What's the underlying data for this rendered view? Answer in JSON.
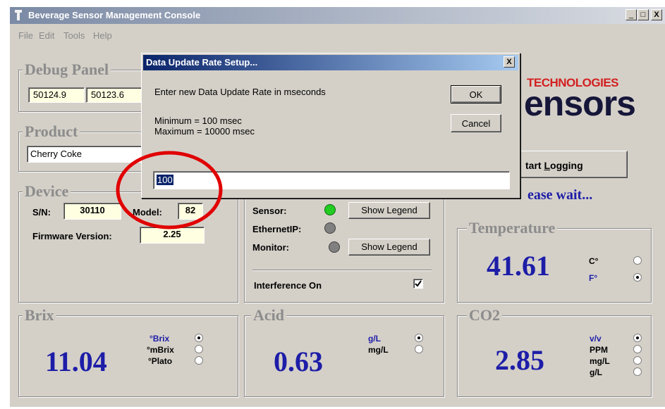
{
  "window": {
    "title": "Beverage Sensor Management Console",
    "controls": {
      "minimize": "_",
      "maximize": "□",
      "close": "X"
    }
  },
  "menu": [
    "File",
    "Edit",
    "Tools",
    "Help"
  ],
  "debug_panel": {
    "title": "Debug Panel",
    "values": [
      "50124.9",
      "50123.6"
    ]
  },
  "logo": {
    "line1": "TECHNOLOGIES",
    "line2": "ensors"
  },
  "product": {
    "title": "Product",
    "value": "Cherry Coke"
  },
  "start_logging": {
    "prefix": "tart ",
    "underlined": "L",
    "rest": "ogging"
  },
  "please_wait": "ease wait...",
  "device": {
    "title": "Device",
    "sn_label": "S/N:",
    "sn_value": "30110",
    "model_label": "Model:",
    "model_value": "82",
    "firmware_label": "Firmware Version:",
    "firmware_value": "2.25"
  },
  "status": {
    "sensor_label": "Sensor:",
    "sensor_led": "#22cc22",
    "ethernet_label": "EthernetIP:",
    "ethernet_led": "#808080",
    "monitor_label": "Monitor:",
    "monitor_led": "#808080",
    "legend_button": "Show Legend",
    "interference_label": "Interference On",
    "interference_checked": true
  },
  "temperature": {
    "title": "Temperature",
    "value": "41.61",
    "units": [
      {
        "label": "C°",
        "selected": false
      },
      {
        "label": "F°",
        "selected": true
      }
    ]
  },
  "brix": {
    "title": "Brix",
    "value": "11.04",
    "units": [
      {
        "label": "°Brix",
        "selected": true
      },
      {
        "label": "°mBrix",
        "selected": false
      },
      {
        "label": "°Plato",
        "selected": false
      }
    ]
  },
  "acid": {
    "title": "Acid",
    "value": "0.63",
    "units": [
      {
        "label": "g/L",
        "selected": true
      },
      {
        "label": "mg/L",
        "selected": false
      }
    ]
  },
  "co2": {
    "title": "CO2",
    "value": "2.85",
    "units": [
      {
        "label": "v/v",
        "selected": true
      },
      {
        "label": "PPM",
        "selected": false
      },
      {
        "label": "mg/L",
        "selected": false
      },
      {
        "label": "g/L",
        "selected": false
      }
    ]
  },
  "dialog": {
    "title": "Data Update Rate Setup...",
    "close": "X",
    "prompt": "Enter new Data Update Rate in mseconds",
    "minimum": "Minimum = 100 msec",
    "maximum": "Maximum = 10000 msec",
    "ok": "OK",
    "cancel": "Cancel",
    "input_value": "100"
  },
  "colors": {
    "value_blue": "#1d1da8",
    "annotation_red": "#e00000",
    "dialog_title": "#0a246a"
  }
}
